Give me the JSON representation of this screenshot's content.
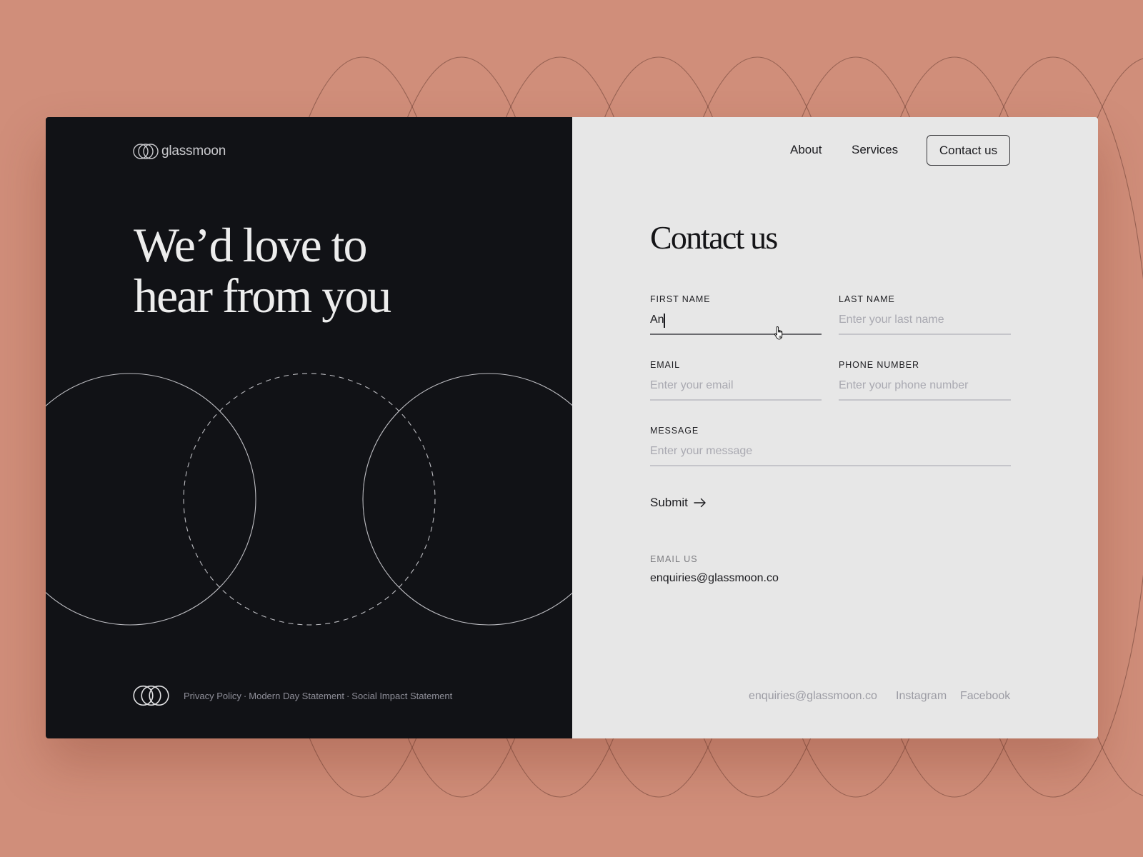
{
  "brand": {
    "name": "glassmoon",
    "logo_icon": "three-rings-logo-icon"
  },
  "nav": {
    "items": [
      {
        "label": "About"
      },
      {
        "label": "Services"
      }
    ],
    "cta_label": "Contact us"
  },
  "hero": {
    "line1": "We’d love to",
    "line2": "hear from you"
  },
  "form": {
    "title": "Contact us",
    "fields": [
      {
        "label": "FIRST NAME",
        "value": "An",
        "state": "focused"
      },
      {
        "label": "LAST NAME",
        "placeholder": "Enter your last name"
      },
      {
        "label": "EMAIL",
        "placeholder": "Enter your email"
      },
      {
        "label": "PHONE NUMBER",
        "placeholder": "Enter your phone number"
      },
      {
        "label": "MESSAGE",
        "placeholder": "Enter your message"
      }
    ],
    "submit_label": "Submit",
    "submit_icon": "arrow-right-icon"
  },
  "contact": {
    "label": "EMAIL US",
    "email": "enquiries@glassmoon.co"
  },
  "footer": {
    "left_links": [
      "Privacy Policy",
      "Modern Day Statement",
      "Social Impact Statement"
    ],
    "separator": "·",
    "right_links": [
      "enquiries@glassmoon.co",
      "Instagram",
      "Facebook"
    ]
  },
  "colors": {
    "background": "#D08E7A",
    "dark_panel": "#111216",
    "light_panel": "#E7E7E7",
    "text_dark": "#1B1B1F",
    "text_muted": "#9C9CA4",
    "placeholder": "#A9A9B1"
  }
}
